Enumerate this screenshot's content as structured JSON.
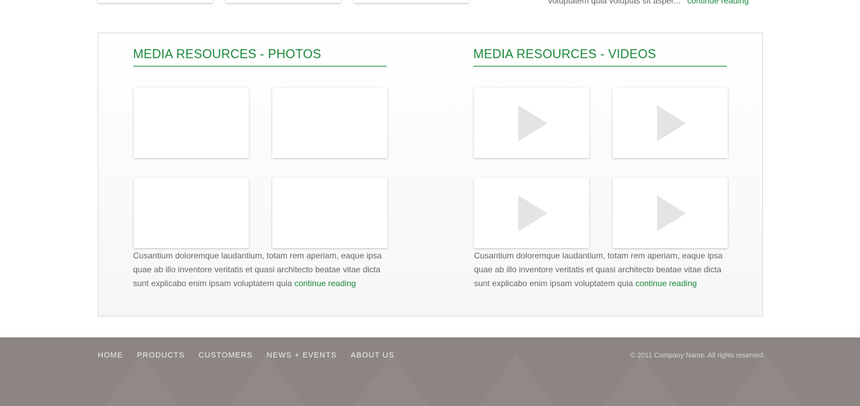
{
  "top": {
    "snippet": "voluptatem quia voluptas sit asper...",
    "link": "continue reading"
  },
  "photos": {
    "title": "MEDIA RESOURCES - PHOTOS",
    "description": "Cusantium doloremque laudantium, totam rem aperiam, eaque ipsa quae ab illo inventore veritatis et quasi architecto beatae vitae dicta sunt explicabo enim ipsam voluptatem quia",
    "link": "continue reading"
  },
  "videos": {
    "title": "MEDIA RESOURCES - VIDEOS",
    "description": "Cusantium doloremque laudantium, totam rem aperiam, eaque ipsa quae ab illo inventore veritatis et quasi architecto beatae vitae dicta sunt explicabo enim ipsam voluptatem quia",
    "link": "continue reading",
    "thumb_icon": "play-icon"
  },
  "footer": {
    "nav": [
      "HOME",
      "PRODUCTS",
      "CUSTOMERS",
      "NEWS + EVENTS",
      "ABOUT US"
    ],
    "copyright": "© 2011 Company Name. All rights reserved."
  },
  "colors": {
    "accent": "#1a8a3a",
    "footer_bg": "#8c8583",
    "text": "#666666"
  }
}
